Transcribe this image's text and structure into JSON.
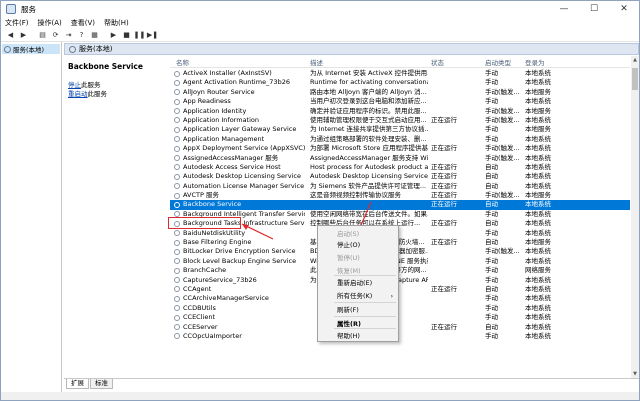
{
  "window": {
    "title": "服务",
    "controls": {
      "minimize": "—",
      "maximize": "☐",
      "close": "✕"
    }
  },
  "menu": [
    "文件(F)",
    "操作(A)",
    "查看(V)",
    "帮助(H)"
  ],
  "toolbar_icons": [
    "back-icon",
    "forward-icon",
    "console-icon",
    "refresh-icon",
    "export-icon",
    "help-icon",
    "properties-icon",
    "play-icon",
    "stop-icon",
    "pause-icon",
    "resume-icon"
  ],
  "tree": {
    "selected": "服务(本地)"
  },
  "main_header": "服务(本地)",
  "description_pane": {
    "title": "Backbone Service",
    "link_stop": "停止",
    "link_stop_suffix": "此服务",
    "link_restart": "重启动",
    "link_restart_suffix": "此服务"
  },
  "columns": {
    "name": "名称",
    "description": "描述",
    "status": "状态",
    "startup": "启动类型",
    "logon": "登录为"
  },
  "services": [
    {
      "name": "ActiveX Installer (AxInstSV)",
      "desc": "为从 Internet 安装 ActiveX 控件提供用...",
      "status": "",
      "startup": "手动",
      "logon": "本地系统"
    },
    {
      "name": "Agent Activation Runtime_73b26",
      "desc": "Runtime for activating conversational ...",
      "status": "",
      "startup": "手动",
      "logon": "本地系统"
    },
    {
      "name": "AllJoyn Router Service",
      "desc": "路由本地 AllJoyn 客户端的 AllJoyn 消...",
      "status": "",
      "startup": "手动(触发...",
      "logon": "本地服务"
    },
    {
      "name": "App Readiness",
      "desc": "当用户初次登录到这台电脑和添加新应...",
      "status": "",
      "startup": "手动",
      "logon": "本地系统"
    },
    {
      "name": "Application Identity",
      "desc": "确定并验证应用程序的标识。禁用此服...",
      "status": "",
      "startup": "手动(触发...",
      "logon": "本地服务"
    },
    {
      "name": "Application Information",
      "desc": "使用辅助管理权限便于交互式启动应用...",
      "status": "正在运行",
      "startup": "手动(触发...",
      "logon": "本地系统"
    },
    {
      "name": "Application Layer Gateway Service",
      "desc": "为 Internet 连接共享提供第三方协议插...",
      "status": "",
      "startup": "手动",
      "logon": "本地服务"
    },
    {
      "name": "Application Management",
      "desc": "为通过组策略部署的软件处理安装、删...",
      "status": "",
      "startup": "手动",
      "logon": "本地系统"
    },
    {
      "name": "AppX Deployment Service (AppXSVC)",
      "desc": "为部署 Microsoft Store 应用程序提供基...",
      "status": "正在运行",
      "startup": "手动(触发...",
      "logon": "本地系统"
    },
    {
      "name": "AssignedAccessManager 服务",
      "desc": "AssignedAccessManager 服务支持 Win...",
      "status": "",
      "startup": "手动(触发...",
      "logon": "本地系统"
    },
    {
      "name": "Autodesk Access Service Host",
      "desc": "Host process for Autodesk product a...",
      "status": "正在运行",
      "startup": "自动",
      "logon": "本地系统"
    },
    {
      "name": "Autodesk Desktop Licensing Service",
      "desc": "Autodesk Desktop Licensing Service",
      "status": "正在运行",
      "startup": "自动",
      "logon": "本地系统"
    },
    {
      "name": "Automation License Manager Service",
      "desc": "为 Siemens 软件产品提供许可证管理...",
      "status": "正在运行",
      "startup": "自动",
      "logon": "本地系统"
    },
    {
      "name": "AVCTP 服务",
      "desc": "这是音频视频控制传输协议服务",
      "status": "正在运行",
      "startup": "手动(触发...",
      "logon": "本地服务"
    },
    {
      "name": "Backbone Service",
      "desc": "",
      "status": "正在运行",
      "startup": "自动",
      "logon": "本地系统"
    },
    {
      "name": "Background Intelligent Transfer Service",
      "desc": "使用空闲网络带宽在后台传送文件。如果...",
      "status": "",
      "startup": "手动",
      "logon": "本地系统"
    },
    {
      "name": "Background Tasks Infrastructure Service",
      "desc": "控制哪些后台任务可以在系统上运行...",
      "status": "正在运行",
      "startup": "自动",
      "logon": "本地系统"
    },
    {
      "name": "BaiduNetdiskUtility",
      "desc": "",
      "status": "",
      "startup": "手动",
      "logon": "本地系统"
    },
    {
      "name": "Base Filtering Engine",
      "desc": "基本筛选引擎(BFE)是一种管理防火墙...",
      "status": "正在运行",
      "startup": "自动",
      "logon": "本地服务"
    },
    {
      "name": "BitLocker Drive Encryption Service",
      "desc": "BDESVC 承载 BitLocker 驱动器加密服...",
      "status": "",
      "startup": "手动(触发...",
      "logon": "本地系统"
    },
    {
      "name": "Block Level Backup Engine Service",
      "desc": "Windows 备份使用 WBENGINE 服务执行...",
      "status": "",
      "startup": "手动",
      "logon": "本地系统"
    },
    {
      "name": "BranchCache",
      "desc": "此服务缓存来自本地子网上对等方的网...",
      "status": "",
      "startup": "手动",
      "logon": "网络服务"
    },
    {
      "name": "CaptureService_73b26",
      "desc": "为调用 Windows.Graphics.Capture API...",
      "status": "",
      "startup": "手动",
      "logon": "本地系统"
    },
    {
      "name": "CCAgent",
      "desc": "",
      "status": "正在运行",
      "startup": "自动",
      "logon": "本地系统"
    },
    {
      "name": "CCArchiveManagerService",
      "desc": "",
      "status": "",
      "startup": "手动",
      "logon": "本地系统"
    },
    {
      "name": "CCDBUtils",
      "desc": "",
      "status": "",
      "startup": "手动",
      "logon": "本地系统"
    },
    {
      "name": "CCEClient",
      "desc": "",
      "status": "",
      "startup": "手动",
      "logon": "本地系统"
    },
    {
      "name": "CCEServer",
      "desc": "",
      "status": "正在运行",
      "startup": "自动",
      "logon": "本地系统"
    },
    {
      "name": "CCOpcUaImporter",
      "desc": "",
      "status": "",
      "startup": "手动",
      "logon": "本地系统"
    }
  ],
  "context_menu": [
    {
      "label": "启动(S)",
      "state": "disabled"
    },
    {
      "label": "停止(O)",
      "state": "enabled"
    },
    {
      "label": "暂停(U)",
      "state": "disabled"
    },
    {
      "label": "恢复(M)",
      "state": "disabled"
    },
    {
      "label": "重新启动(E)",
      "state": "enabled"
    },
    {
      "label": "所有任务(K)",
      "state": "submenu"
    },
    {
      "label": "刷新(F)",
      "state": "enabled"
    },
    {
      "label": "属性(R)",
      "state": "bold"
    },
    {
      "label": "帮助(H)",
      "state": "enabled"
    }
  ],
  "tabs": [
    "扩展",
    "标准"
  ],
  "colors": {
    "selection": "#0078d7",
    "annotation": "#e0282c",
    "link": "#0645ad"
  }
}
